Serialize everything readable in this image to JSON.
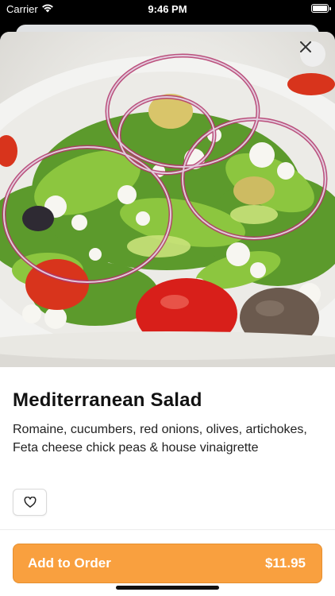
{
  "status_bar": {
    "carrier": "Carrier",
    "time": "9:46 PM",
    "wifi_icon": "wifi-icon",
    "battery_icon": "battery-icon"
  },
  "item": {
    "name": "Mediterranean Salad",
    "description": "Romaine, cucumbers, red onions, olives, artichokes, Feta cheese chick peas & house vinaigrette",
    "image_subject": "salad-photo"
  },
  "actions": {
    "close_icon": "close-icon",
    "favorite_icon": "heart-icon",
    "add_to_order_label": "Add to Order",
    "price": "$11.95"
  },
  "colors": {
    "accent": "#f9a03f",
    "accent_border": "#e58f2f",
    "text_primary": "#111111"
  }
}
